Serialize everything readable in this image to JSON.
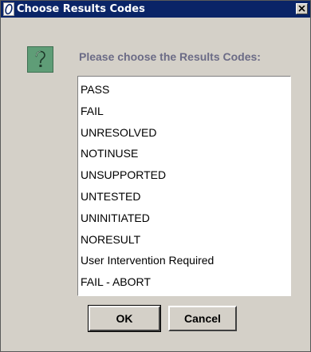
{
  "dialog": {
    "title": "Choose Results Codes",
    "prompt": "Please choose the Results Codes:",
    "icon": "help-icon",
    "close_icon": "close-icon"
  },
  "results_codes": [
    "PASS",
    "FAIL",
    "UNRESOLVED",
    "NOTINUSE",
    "UNSUPPORTED",
    "UNTESTED",
    "UNINITIATED",
    "NORESULT",
    "User Intervention Required",
    "FAIL - ABORT"
  ],
  "buttons": {
    "ok_label": "OK",
    "cancel_label": "Cancel"
  },
  "colors": {
    "titlebar": "#0a2467",
    "dialog_bg": "#d4d0c8",
    "prompt_text": "#6b6b86",
    "help_icon_bg": "#5f9d77"
  }
}
